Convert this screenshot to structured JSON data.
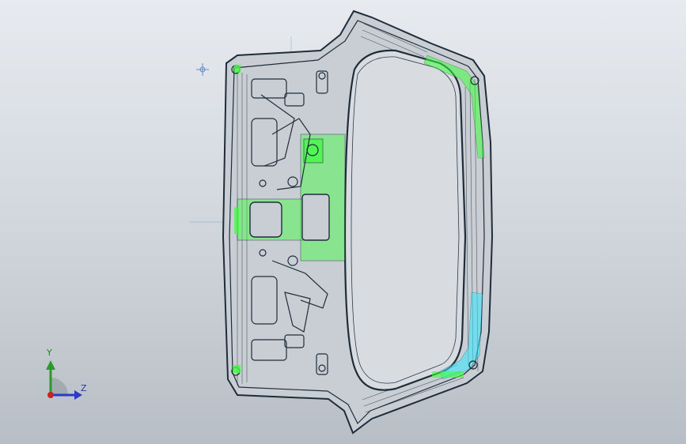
{
  "window": {
    "title": ""
  },
  "triad": {
    "y_label": "Y",
    "z_label": "Z"
  },
  "colors": {
    "background_top": "#e7ebf0",
    "background_bottom": "#b8bec5",
    "wire": "#1f2d3a",
    "highlight_green": "#3cff3c",
    "highlight_cyan": "#33e6ff",
    "axis_y": "#2a9a2a",
    "axis_z": "#2a3aca",
    "axis_x": "#cc2222"
  },
  "model": {
    "icon": "tailgate-inner-panel-wireframe"
  }
}
